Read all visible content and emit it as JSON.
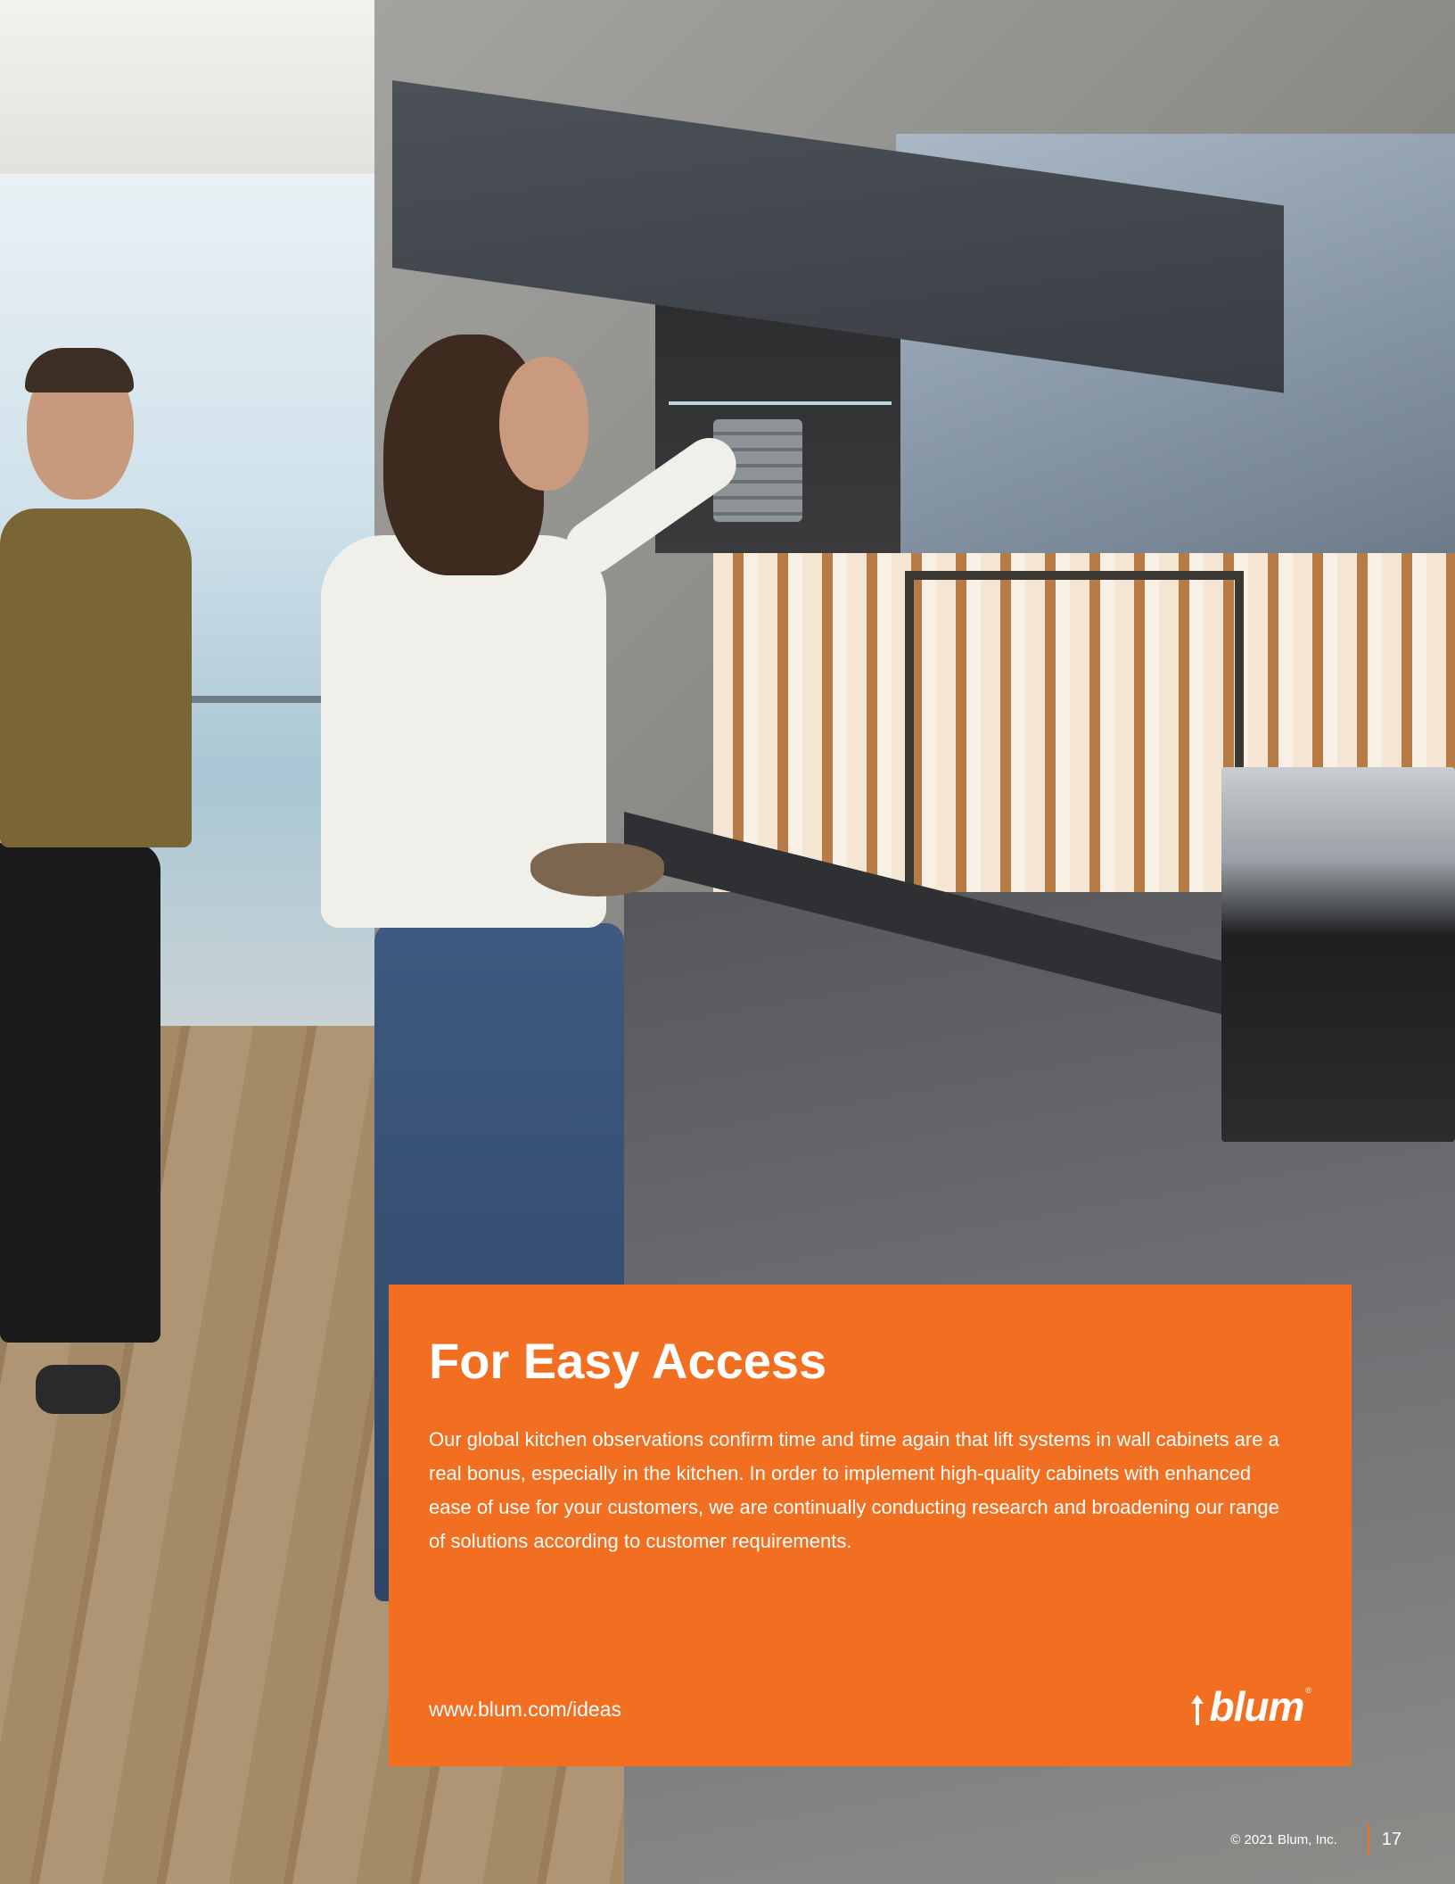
{
  "panel": {
    "title": "For Easy Access",
    "body": "Our global kitchen observations confirm time and time again that lift systems in wall cabinets are a real bonus, especially in the kitchen. In order to implement high-quality cabinets with enhanced ease of use for your customers, we are continually conducting research and broadening our range of solutions according to customer requirements.",
    "url": "www.blum.com/ideas",
    "logo_text": "blum",
    "logo_mark": "®",
    "background_color": "#f26f21"
  },
  "footer": {
    "copyright": "© 2021 Blum, Inc.",
    "page_number": "17"
  }
}
